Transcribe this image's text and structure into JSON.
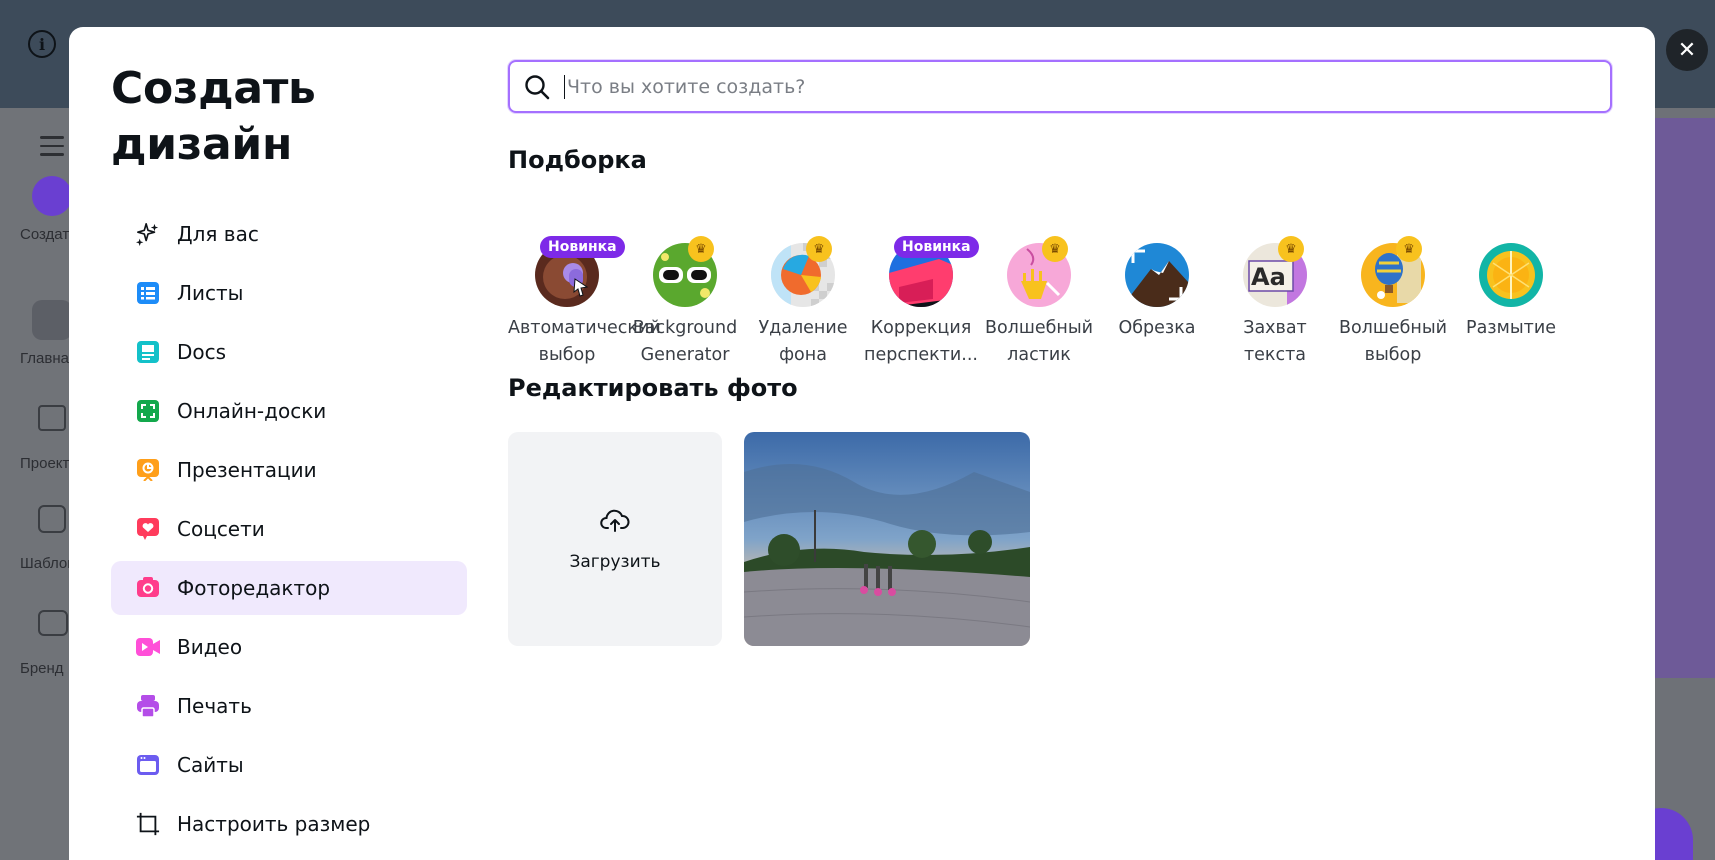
{
  "background": {
    "rail_items": [
      {
        "label": "Создать",
        "icon": "plus-icon"
      },
      {
        "label": "Главная",
        "icon": "home-icon"
      },
      {
        "label": "Проекты",
        "icon": "folder-icon"
      },
      {
        "label": "Шаблоны",
        "icon": "layout-icon"
      },
      {
        "label": "Бренд",
        "icon": "brand-icon"
      }
    ]
  },
  "modal": {
    "title": "Создать дизайн",
    "close_icon": "close-icon"
  },
  "sidebar": {
    "items": [
      {
        "label": "Для вас",
        "icon": "sparkle-icon",
        "active": false
      },
      {
        "label": "Листы",
        "icon": "sheets-icon",
        "active": false
      },
      {
        "label": "Docs",
        "icon": "docs-icon",
        "active": false
      },
      {
        "label": "Онлайн-доски",
        "icon": "whiteboard-icon",
        "active": false
      },
      {
        "label": "Презентации",
        "icon": "presentation-icon",
        "active": false
      },
      {
        "label": "Соцсети",
        "icon": "heart-icon",
        "active": false
      },
      {
        "label": "Фоторедактор",
        "icon": "camera-icon",
        "active": true
      },
      {
        "label": "Видео",
        "icon": "video-icon",
        "active": false
      },
      {
        "label": "Печать",
        "icon": "print-icon",
        "active": false
      },
      {
        "label": "Сайты",
        "icon": "website-icon",
        "active": false
      },
      {
        "label": "Настроить размер",
        "icon": "resize-icon",
        "active": false
      }
    ]
  },
  "search": {
    "placeholder": "Что вы хотите создать?",
    "value": ""
  },
  "featured": {
    "title": "Подборка",
    "tools": [
      {
        "label": "Автоматический выбор",
        "badge": "Новинка"
      },
      {
        "label": "Background Generator",
        "badge": "crown"
      },
      {
        "label": "Удаление фона",
        "badge": "crown"
      },
      {
        "label": "Коррекция перспекти...",
        "badge": "Новинка"
      },
      {
        "label": "Волшебный ластик",
        "badge": "crown"
      },
      {
        "label": "Обрезка",
        "badge": ""
      },
      {
        "label": "Захват текста",
        "badge": "crown"
      },
      {
        "label": "Волшебный выбор",
        "badge": "crown"
      },
      {
        "label": "Размытие",
        "badge": ""
      }
    ]
  },
  "edit_photo": {
    "title": "Редактировать фото",
    "upload_label": "Загрузить"
  },
  "colors": {
    "accent": "#7d2ae8",
    "active_bg": "#f0e9fd",
    "search_border": "#a570ff"
  }
}
